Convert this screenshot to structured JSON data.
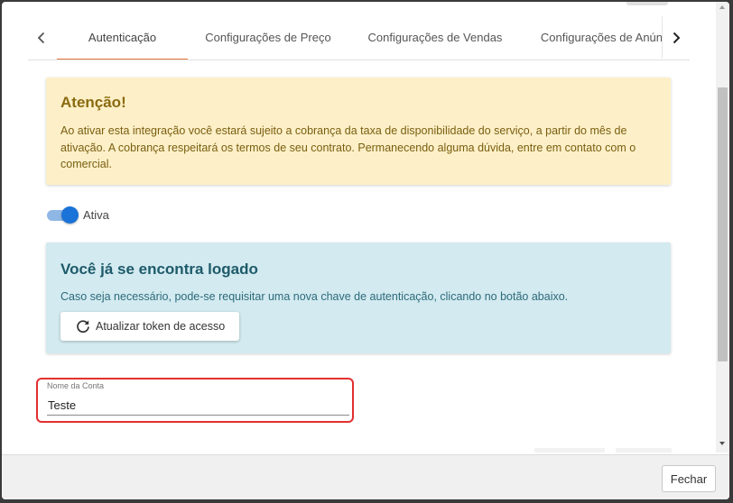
{
  "tabs": {
    "items": [
      {
        "label": "Autenticação"
      },
      {
        "label": "Configurações de Preço"
      },
      {
        "label": "Configurações de Vendas"
      },
      {
        "label": "Configurações de Anúncios"
      }
    ],
    "active_index": 0,
    "accent_color": "#e8793a",
    "prev_icon": "chevron-left-icon",
    "next_icon": "chevron-right-icon"
  },
  "warning": {
    "title": "Atenção!",
    "text": "Ao ativar esta integração você estará sujeito a cobrança da taxa de disponibilidade do serviço, a partir do mês de ativação. A cobrança respeitará os termos de seu contrato. Permanecendo alguma dúvida, entre em contato com o comercial.",
    "background_color": "#fdf0c8"
  },
  "toggle": {
    "label": "Ativa",
    "checked": true,
    "color": "#1a73d8"
  },
  "info": {
    "title": "Você já se encontra logado",
    "text": "Caso seja necessário, pode-se requisitar uma nova chave de autenticação, clicando no botão abaixo.",
    "button_label": "Atualizar token de acesso",
    "button_icon": "refresh-icon",
    "background_color": "#d2eaf0"
  },
  "account_field": {
    "label": "Nome da Conta",
    "value": "Teste",
    "highlight_color": "#e23030"
  },
  "footer": {
    "close_label": "Fechar"
  }
}
